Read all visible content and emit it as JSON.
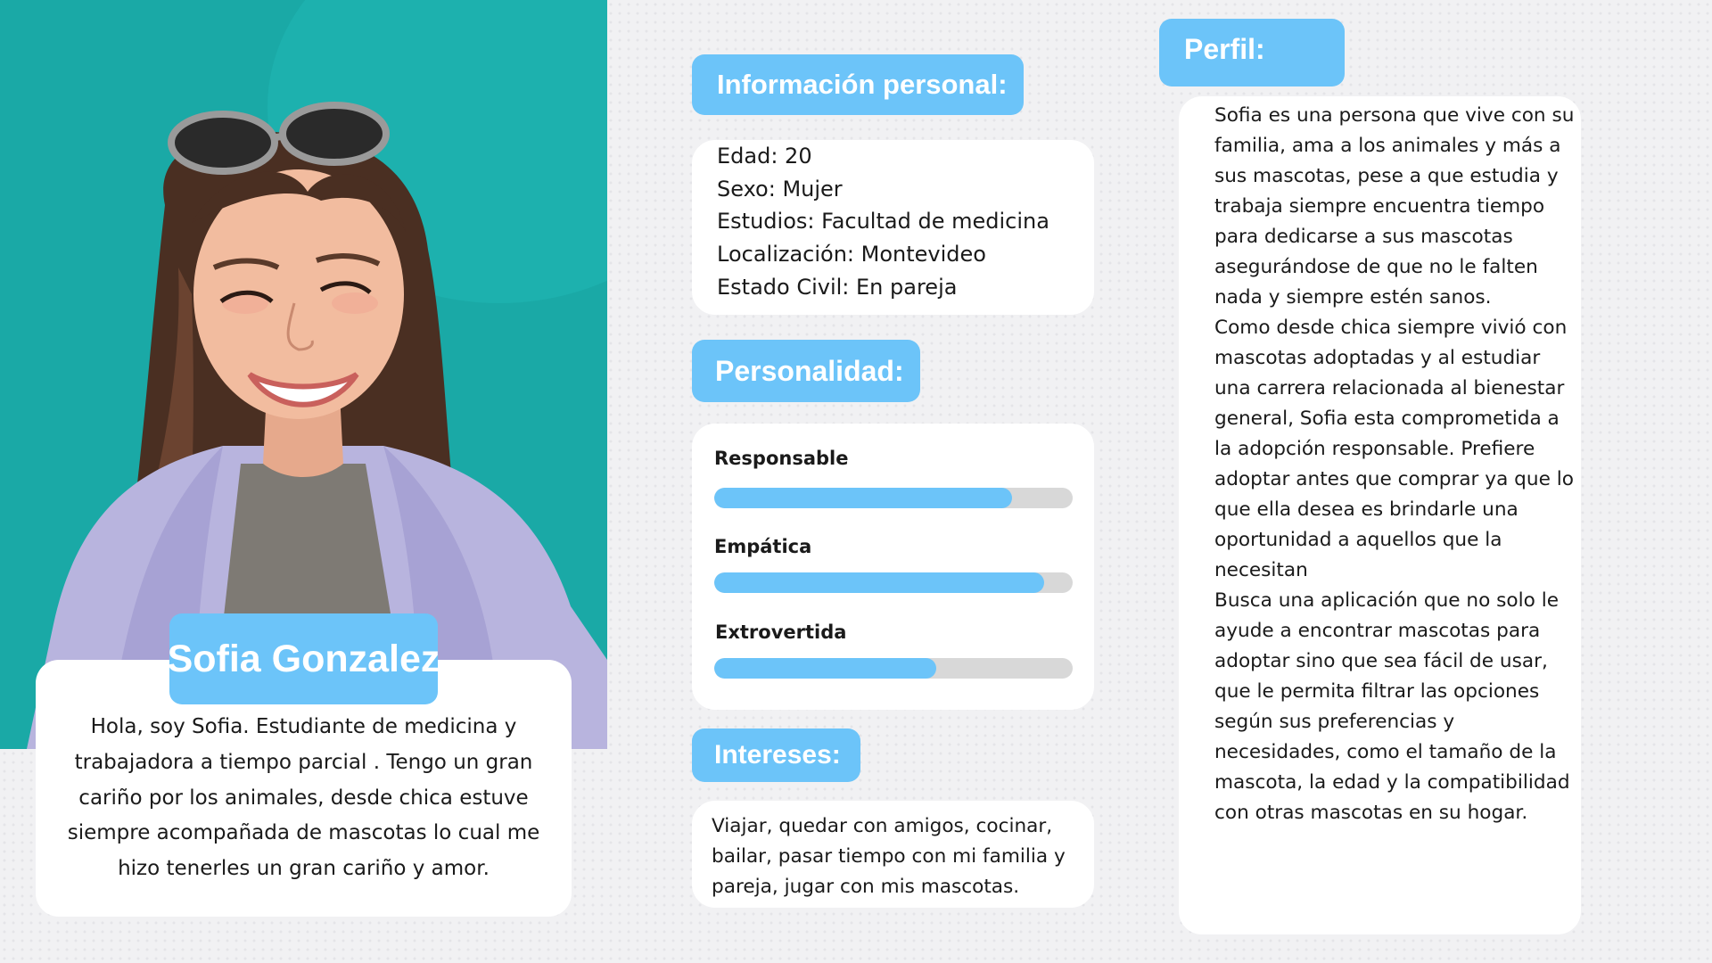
{
  "name": "Sofia Gonzalez",
  "bio": "Hola, soy Sofia. Estudiante de medicina y trabajadora a tiempo parcial . Tengo un gran cariño por los animales, desde chica estuve siempre acompañada de mascotas lo cual me hizo tenerles un gran cariño y amor.",
  "personal_info": {
    "title": "Información personal:",
    "lines": [
      "Edad: 20",
      "Sexo: Mujer",
      "Estudios: Facultad de medicina",
      "Localización: Montevideo",
      "Estado Civil: En pareja"
    ]
  },
  "personality": {
    "title": "Personalidad:",
    "traits": [
      {
        "label": "Responsable",
        "value": 0.83
      },
      {
        "label": "Empática",
        "value": 0.92
      },
      {
        "label": "Extrovertida",
        "value": 0.62
      }
    ]
  },
  "interests": {
    "title": "Intereses:",
    "text": "Viajar, quedar con amigos, cocinar, bailar, pasar tiempo con mi familia y pareja, jugar con mis mascotas."
  },
  "profile": {
    "title": "Perfil:",
    "paragraphs": [
      "Sofia es una persona que vive con su familia, ama a los animales y más a sus mascotas, pese a que estudia y trabaja siempre encuentra tiempo para dedicarse a sus mascotas asegurándose de que no le falten nada y siempre estén sanos.",
      "Como desde chica siempre vivió con mascotas adoptadas y al estudiar una carrera relacionada al bienestar general, Sofia esta comprometida a la adopción responsable. Prefiere adoptar antes que comprar ya que lo que ella desea es brindarle una oportunidad a aquellos  que la necesitan",
      "Busca una aplicación que no solo le ayude a encontrar mascotas para adoptar sino que sea fácil de usar, que le permita filtrar las opciones según sus preferencias y necesidades, como el tamaño de la mascota, la edad y la compatibilidad con otras mascotas en su hogar."
    ]
  },
  "colors": {
    "accent": "#6cc4f9",
    "photo_bg": "#1aa9a6",
    "bar_track": "#d8d8d8"
  }
}
